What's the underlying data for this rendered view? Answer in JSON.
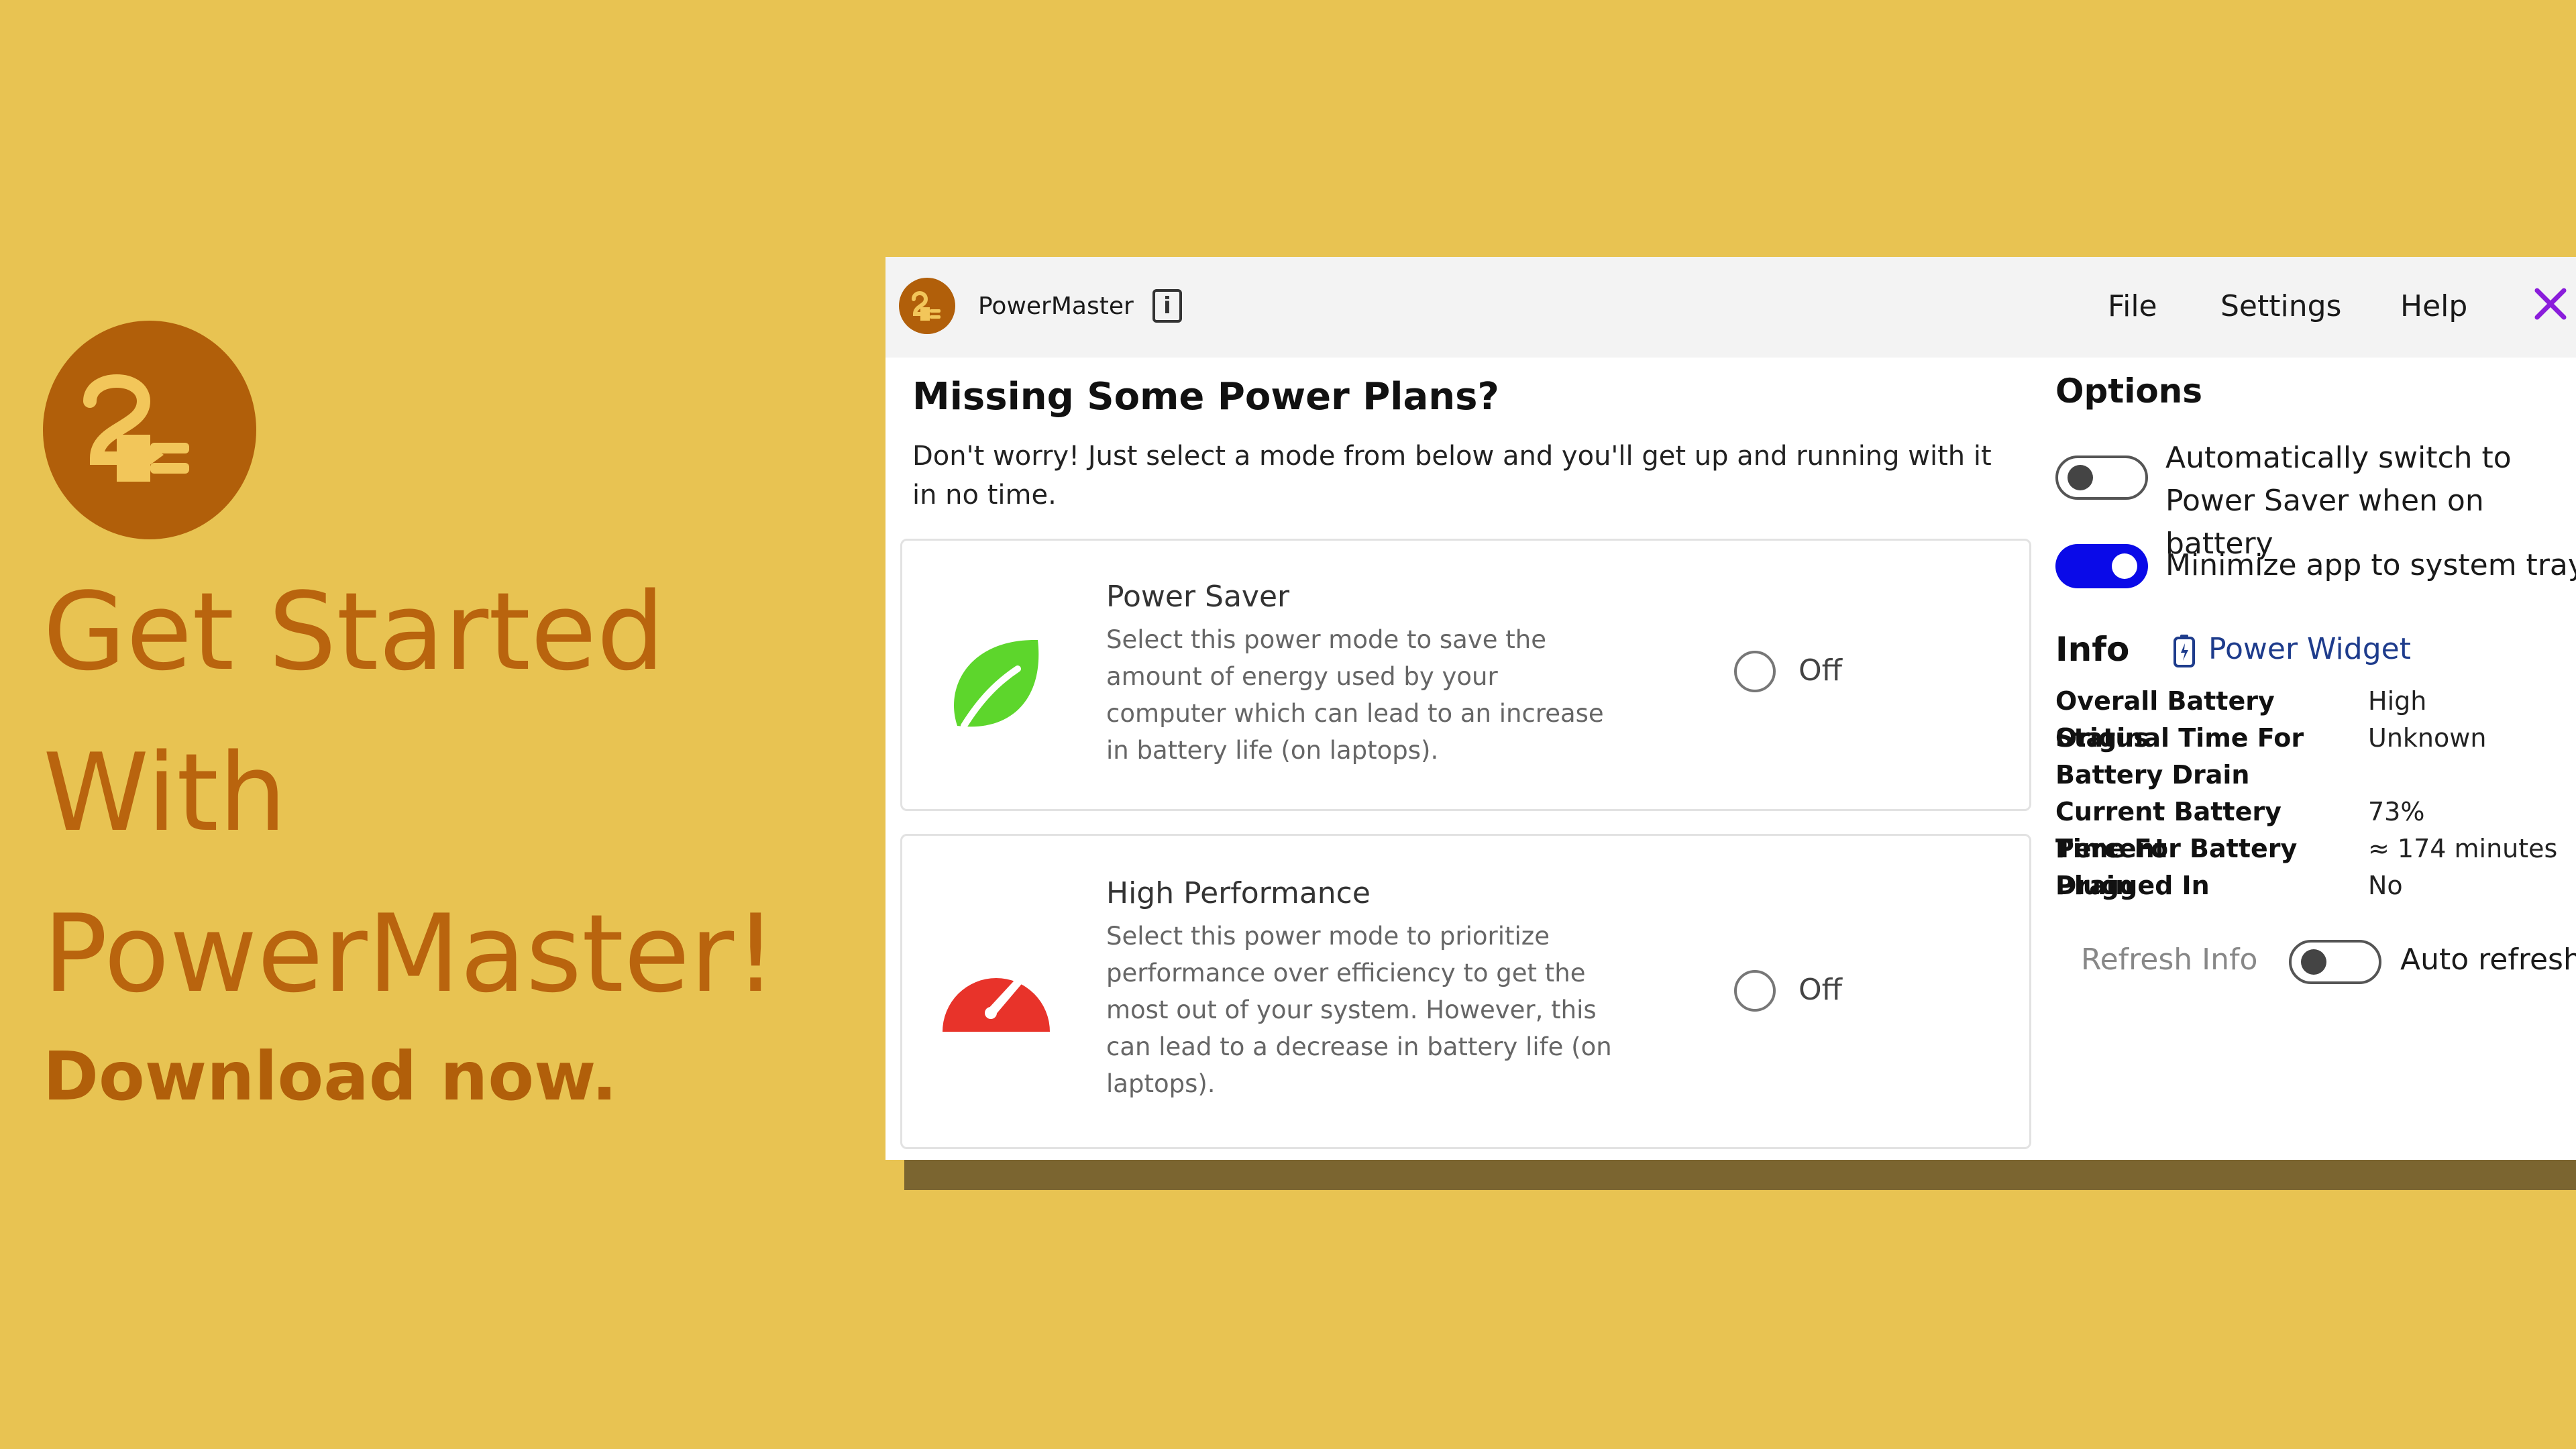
{
  "promo": {
    "title_lines": [
      "Get Started",
      "With",
      "PowerMaster!"
    ],
    "cta": "Download now.",
    "logo_icon": "plug-logo-icon"
  },
  "window": {
    "app_name": "PowerMaster",
    "info_label": "i",
    "menu": {
      "file": "File",
      "settings": "Settings",
      "help": "Help"
    },
    "close_icon": "close-icon",
    "accent": "#8A1DDB"
  },
  "main": {
    "heading": "Missing Some Power Plans?",
    "subheading": "Don't worry! Just select a mode from below and you'll get up and running with it in no time.",
    "plans": [
      {
        "title": "Power Saver",
        "description": "Select this power mode to save the amount of energy used by your computer which can lead to an increase in battery life (on laptops).",
        "state": "Off",
        "icon": "leaf-icon",
        "color": "#5DD62C"
      },
      {
        "title": "High Performance",
        "description": "Select this power mode to prioritize performance over efficiency to get the most out of your system. However, this can lead to a decrease in battery life (on laptops).",
        "state": "Off",
        "icon": "speedometer-icon",
        "color": "#E8332A"
      }
    ]
  },
  "options": {
    "title": "Options",
    "auto_switch_label": "Automatically switch to Power Saver when on battery",
    "auto_switch_on": false,
    "minimize_label": "Minimize app to system tray",
    "minimize_on": true,
    "toggle_on_color": "#0A0AE8"
  },
  "info": {
    "title": "Info",
    "widget_link": "Power Widget",
    "rows": [
      {
        "key": "Overall Battery Status",
        "value": "High"
      },
      {
        "key": "Original Time For Battery Drain",
        "value": "Unknown"
      },
      {
        "key": "Current Battery Percent",
        "value": "73%"
      },
      {
        "key": "Time For Battery Drain",
        "value": "≈ 174 minutes"
      },
      {
        "key": "Plugged In",
        "value": "No"
      }
    ],
    "refresh_label": "Refresh Info",
    "auto_refresh_label": "Auto refresh",
    "auto_refresh_on": false
  }
}
